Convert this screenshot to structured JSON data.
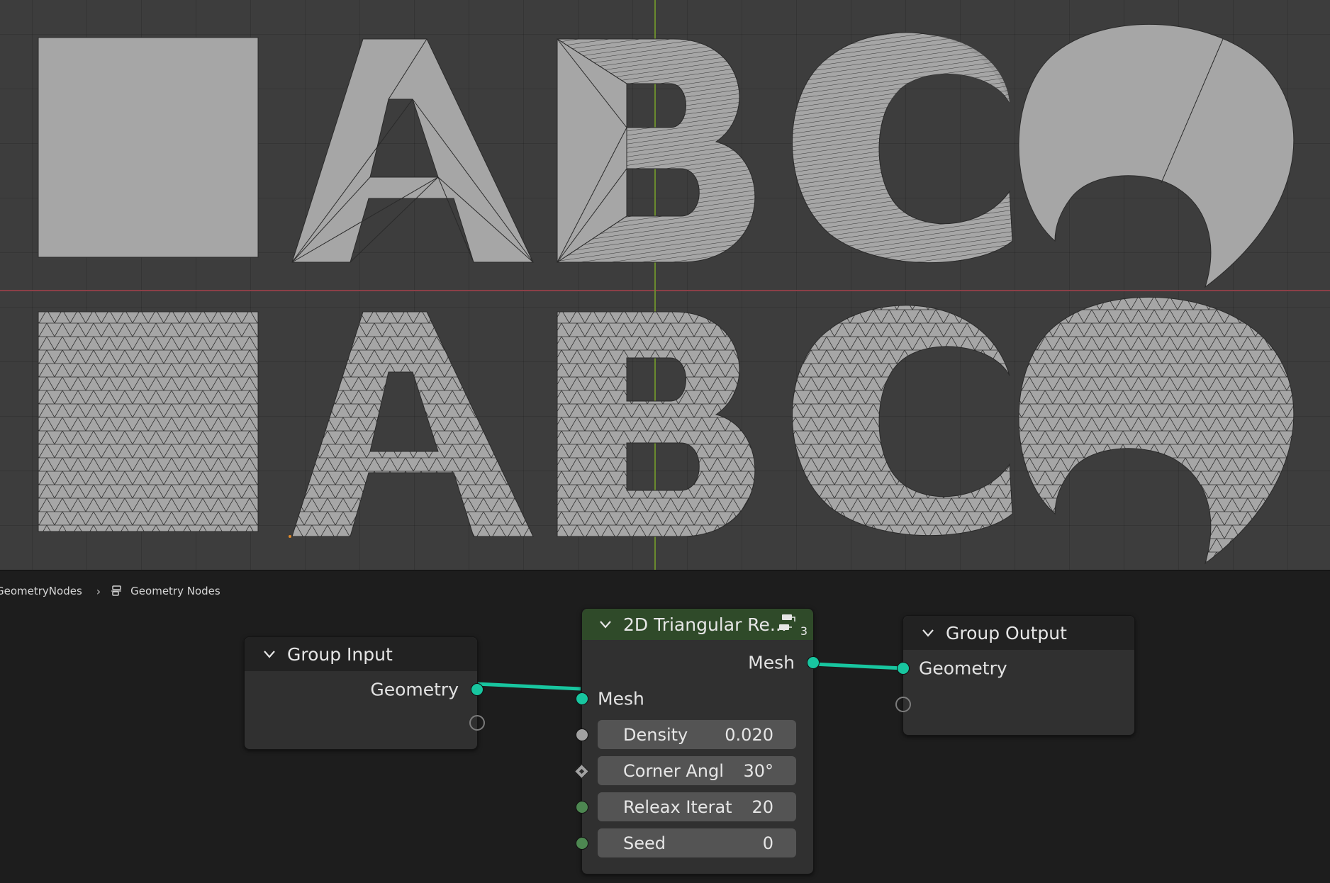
{
  "viewport": {
    "background": "#3d3d3d",
    "mesh_fill": "#a6a6a6",
    "wire_color": "#2a2a2a",
    "top_row_glyphs": [
      "A",
      "B",
      "C"
    ],
    "bottom_row_glyphs": [
      "A",
      "B",
      "C"
    ]
  },
  "breadcrumb": {
    "items": [
      "GeometryNodes",
      "Geometry Nodes"
    ],
    "separator_icon": "chevron-right-icon",
    "tree_icon": "node-tree-icon"
  },
  "nodes": {
    "group_input": {
      "title": "Group Input",
      "outputs": [
        "Geometry"
      ]
    },
    "remesh": {
      "title": "2D Triangular Re...",
      "user_count": "3",
      "header_color": "#2f4a29",
      "outputs": [
        "Mesh"
      ],
      "inputs": [
        "Mesh"
      ],
      "fields": [
        {
          "name": "Density",
          "value": "0.020"
        },
        {
          "name": "Corner Angl",
          "value": "30°"
        },
        {
          "name": "Releax Iterat",
          "value": "20"
        },
        {
          "name": "Seed",
          "value": "0"
        }
      ]
    },
    "group_output": {
      "title": "Group Output",
      "inputs": [
        "Geometry"
      ]
    }
  },
  "colors": {
    "geometry_socket": "#18c6a0",
    "float_socket": "#a1a1a1",
    "int_socket": "#4d8751",
    "x_axis": "#8b4048",
    "y_axis": "#6a8a2e"
  }
}
